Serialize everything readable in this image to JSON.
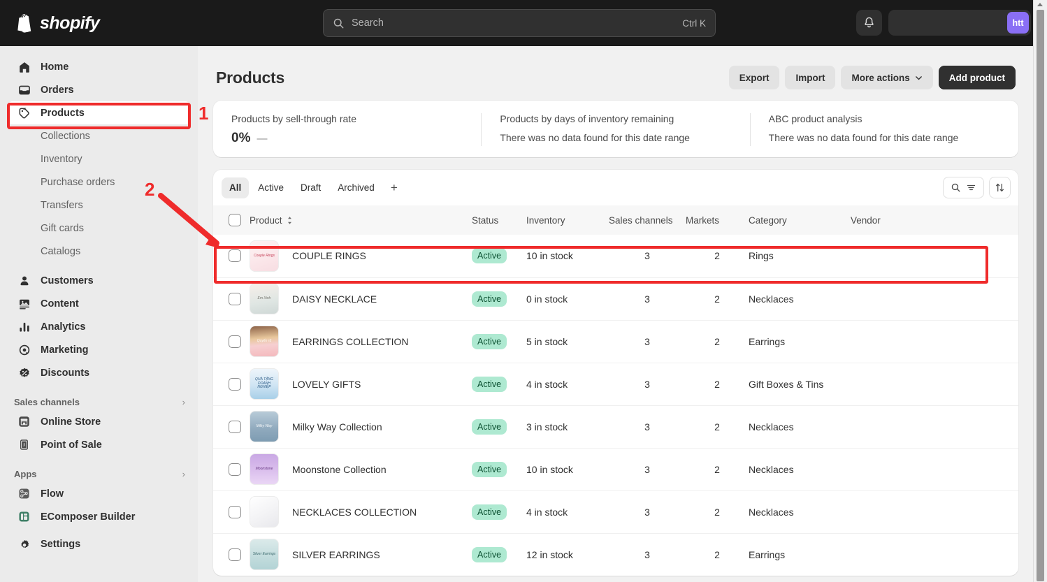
{
  "topbar": {
    "brand": "shopify",
    "search": {
      "placeholder": "Search",
      "shortcut": "Ctrl K",
      "icon": "search-icon"
    },
    "notifications_icon": "bell-icon",
    "store_switcher": {
      "avatar_initials": "htt",
      "avatar_color": "#8a6ff5"
    }
  },
  "sidebar": {
    "primary": [
      {
        "label": "Home",
        "icon": "home-icon",
        "active": false
      },
      {
        "label": "Orders",
        "icon": "orders-icon",
        "active": false
      },
      {
        "label": "Products",
        "icon": "tag-icon",
        "active": true
      }
    ],
    "product_sub": [
      {
        "label": "Collections"
      },
      {
        "label": "Inventory"
      },
      {
        "label": "Purchase orders"
      },
      {
        "label": "Transfers"
      },
      {
        "label": "Gift cards"
      },
      {
        "label": "Catalogs"
      }
    ],
    "secondary": [
      {
        "label": "Customers",
        "icon": "person-icon"
      },
      {
        "label": "Content",
        "icon": "content-icon"
      },
      {
        "label": "Analytics",
        "icon": "analytics-icon"
      },
      {
        "label": "Marketing",
        "icon": "marketing-icon"
      },
      {
        "label": "Discounts",
        "icon": "discount-icon"
      }
    ],
    "sales_channels": {
      "heading": "Sales channels",
      "chevron": "chevron-right-icon",
      "items": [
        {
          "label": "Online Store",
          "icon": "storefront-icon",
          "color": "#4a4a4a"
        },
        {
          "label": "Point of Sale",
          "icon": "pos-icon",
          "color": "#4a4a4a"
        }
      ]
    },
    "apps": {
      "heading": "Apps",
      "chevron": "chevron-right-icon",
      "items": [
        {
          "label": "Flow",
          "icon": "flow-icon",
          "color": "#5c5c5c"
        },
        {
          "label": "EComposer Builder",
          "icon": "ecomposer-icon",
          "color": "#3f7f67"
        }
      ]
    },
    "settings": {
      "label": "Settings",
      "icon": "gear-icon"
    }
  },
  "page": {
    "title": "Products",
    "actions": [
      {
        "label": "Export",
        "name": "export-button",
        "variant": "secondary"
      },
      {
        "label": "Import",
        "name": "import-button",
        "variant": "secondary"
      },
      {
        "label": "More actions",
        "name": "more-actions-button",
        "variant": "secondary",
        "caret": "chevron-down-icon"
      },
      {
        "label": "Add product",
        "name": "add-product-button",
        "variant": "primary"
      }
    ]
  },
  "insights": [
    {
      "title": "Products by sell-through rate",
      "value": "0%",
      "delta": "—"
    },
    {
      "title": "Products by days of inventory remaining",
      "empty": "There was no data found for this date range"
    },
    {
      "title": "ABC product analysis",
      "empty": "There was no data found for this date range"
    }
  ],
  "tabs": [
    {
      "label": "All",
      "selected": true
    },
    {
      "label": "Active",
      "selected": false
    },
    {
      "label": "Draft",
      "selected": false
    },
    {
      "label": "Archived",
      "selected": false
    },
    {
      "label": "+",
      "selected": false,
      "name": "add-view-button"
    }
  ],
  "toolbar": {
    "search_filter_icons": [
      "search-icon",
      "filter-icon"
    ],
    "sort_icon": "sort-icon"
  },
  "table": {
    "columns": [
      {
        "label": "",
        "name": "select-all"
      },
      {
        "label": "Product",
        "sort_icon": "sort-arrows-icon"
      },
      {
        "label": "Status"
      },
      {
        "label": "Inventory"
      },
      {
        "label": "Sales channels"
      },
      {
        "label": "Markets"
      },
      {
        "label": "Category"
      },
      {
        "label": "Vendor"
      }
    ],
    "rows": [
      {
        "product": "COUPLE RINGS",
        "status": "Active",
        "inventory": "10 in stock",
        "inventory_low": false,
        "sales_channels": "3",
        "markets": "2",
        "category": "Rings",
        "vendor": "",
        "thumb_bg": "linear-gradient(160deg,#fdf3f3 0%,#fbe7ea 55%,#f7dde2 100%)",
        "thumb_text": "Couple Rings",
        "thumb_fg": "#c0304a"
      },
      {
        "product": "DAISY NECKLACE",
        "status": "Active",
        "inventory": "0 in stock",
        "inventory_low": true,
        "sales_channels": "3",
        "markets": "2",
        "category": "Necklaces",
        "vendor": "",
        "thumb_bg": "linear-gradient(170deg,#f7efe9 0%,#dfe6e3 60%,#cfd8d6 100%)",
        "thumb_text": "Em Xinh",
        "thumb_fg": "#6a6a62"
      },
      {
        "product": "EARRINGS COLLECTION",
        "status": "Active",
        "inventory": "5 in stock",
        "inventory_low": true,
        "sales_channels": "3",
        "markets": "2",
        "category": "Earrings",
        "vendor": "",
        "thumb_bg": "linear-gradient(175deg,#8d6348 0%,#e8c79c 40%,#f6cfd1 62%,#f4b9bd 100%)",
        "thumb_text": "Quyến rũ",
        "thumb_fg": "#ffffff"
      },
      {
        "product": "LOVELY GIFTS",
        "status": "Active",
        "inventory": "4 in stock",
        "inventory_low": true,
        "sales_channels": "3",
        "markets": "2",
        "category": "Gift Boxes & Tins",
        "vendor": "",
        "thumb_bg": "linear-gradient(180deg,#eef5fb 0%,#cfe4f3 55%,#a8cfe8 100%)",
        "thumb_text": "QUÀ TẶNG DOANH NGHIỆP",
        "thumb_fg": "#1d4f7c"
      },
      {
        "product": "Milky Way Collection",
        "status": "Active",
        "inventory": "3 in stock",
        "inventory_low": true,
        "sales_channels": "3",
        "markets": "2",
        "category": "Necklaces",
        "vendor": "",
        "thumb_bg": "linear-gradient(180deg,#b8cbd8 0%,#8fa9bd 60%,#7e9cb2 100%)",
        "thumb_text": "Milky Way",
        "thumb_fg": "#ffffff"
      },
      {
        "product": "Moonstone Collection",
        "status": "Active",
        "inventory": "10 in stock",
        "inventory_low": false,
        "sales_channels": "3",
        "markets": "2",
        "category": "Necklaces",
        "vendor": "",
        "thumb_bg": "linear-gradient(180deg,#c9a8e4 0%,#d9bdec 50%,#ead6f5 100%)",
        "thumb_text": "Moonstone",
        "thumb_fg": "#5d2b7a"
      },
      {
        "product": "NECKLACES COLLECTION",
        "status": "Active",
        "inventory": "4 in stock",
        "inventory_low": true,
        "sales_channels": "3",
        "markets": "2",
        "category": "Necklaces",
        "vendor": "",
        "thumb_bg": "linear-gradient(150deg,#ffffff 0%,#f3f3f5 55%,#e8e8ec 100%)",
        "thumb_text": "",
        "thumb_fg": "#999999"
      },
      {
        "product": "SILVER EARRINGS",
        "status": "Active",
        "inventory": "12 in stock",
        "inventory_low": false,
        "sales_channels": "3",
        "markets": "2",
        "category": "Earrings",
        "vendor": "",
        "thumb_bg": "linear-gradient(180deg,#dbeaea 0%,#c2dcdd 60%,#b3d3d5 100%)",
        "thumb_text": "Silver Earrings",
        "thumb_fg": "#2f5f63"
      }
    ]
  },
  "annotations": [
    {
      "number": "1",
      "type": "box",
      "target": "sidebar-item-products",
      "color": "#ef2b2b"
    },
    {
      "number": "2",
      "type": "arrow-and-box",
      "target": "table-row-couple-rings",
      "color": "#ef2b2b"
    }
  ]
}
